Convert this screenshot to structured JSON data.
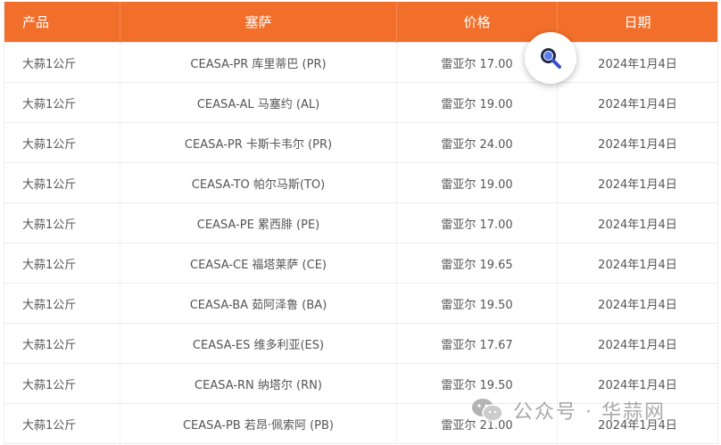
{
  "table": {
    "headers": {
      "product": "产品",
      "ceasa": "塞萨",
      "price": "价格",
      "date": "日期"
    },
    "rows": [
      {
        "product": "大蒜1公斤",
        "ceasa": "CEASA-PR 库里蒂巴 (PR)",
        "price": "雷亚尔 17.00",
        "date": "2024年1月4日"
      },
      {
        "product": "大蒜1公斤",
        "ceasa": "CEASA-AL 马塞约 (AL)",
        "price": "雷亚尔 19.00",
        "date": "2024年1月4日"
      },
      {
        "product": "大蒜1公斤",
        "ceasa": "CEASA-PR 卡斯卡韦尔 (PR)",
        "price": "雷亚尔 24.00",
        "date": "2024年1月4日"
      },
      {
        "product": "大蒜1公斤",
        "ceasa": "CEASA-TO 帕尔马斯(TO)",
        "price": "雷亚尔 19.00",
        "date": "2024年1月4日"
      },
      {
        "product": "大蒜1公斤",
        "ceasa": "CEASA-PE 累西腓 (PE)",
        "price": "雷亚尔 17.00",
        "date": "2024年1月4日"
      },
      {
        "product": "大蒜1公斤",
        "ceasa": "CEASA-CE 福塔莱萨 (CE)",
        "price": "雷亚尔 19.65",
        "date": "2024年1月4日"
      },
      {
        "product": "大蒜1公斤",
        "ceasa": "CEASA-BA 茹阿泽鲁 (BA)",
        "price": "雷亚尔 19.50",
        "date": "2024年1月4日"
      },
      {
        "product": "大蒜1公斤",
        "ceasa": "CEASA-ES 维多利亚(ES)",
        "price": "雷亚尔 17.67",
        "date": "2024年1月4日"
      },
      {
        "product": "大蒜1公斤",
        "ceasa": "CEASA-RN 纳塔尔 (RN)",
        "price": "雷亚尔 19.50",
        "date": "2024年1月4日"
      },
      {
        "product": "大蒜1公斤",
        "ceasa": "CEASA-PB 若昂·佩索阿 (PB)",
        "price": "雷亚尔 21.00",
        "date": "2024年1月4日"
      }
    ]
  },
  "search_button": {
    "icon": "search-icon",
    "color": "#3b4fd6"
  },
  "watermark": {
    "text": "公众号 · 华蒜网",
    "icon": "wechat-logo"
  },
  "colors": {
    "header_bg": "#f26f2b",
    "header_text": "#ffffff",
    "cell_text": "#555555"
  }
}
